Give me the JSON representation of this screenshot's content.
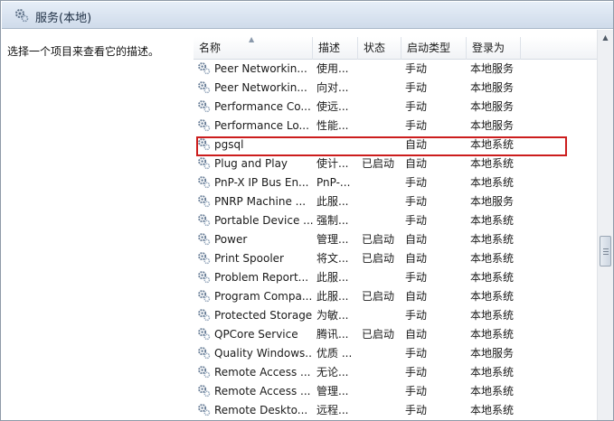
{
  "window": {
    "title": "服务(本地)"
  },
  "left_pane": {
    "description": "选择一个项目来查看它的描述。"
  },
  "columns": {
    "name": "名称",
    "desc": "描述",
    "status": "状态",
    "startup": "启动类型",
    "logon": "登录为"
  },
  "sort": {
    "column": "name",
    "direction": "ascending"
  },
  "services": [
    {
      "name": "Peer Networkin...",
      "desc": "使用...",
      "status": "",
      "startup": "手动",
      "logon": "本地服务"
    },
    {
      "name": "Peer Networkin...",
      "desc": "向对...",
      "status": "",
      "startup": "手动",
      "logon": "本地服务"
    },
    {
      "name": "Performance Co...",
      "desc": "使远...",
      "status": "",
      "startup": "手动",
      "logon": "本地服务"
    },
    {
      "name": "Performance Lo...",
      "desc": "性能...",
      "status": "",
      "startup": "手动",
      "logon": "本地服务"
    },
    {
      "name": "pgsql",
      "desc": "",
      "status": "",
      "startup": "自动",
      "logon": "本地系统",
      "highlighted": true
    },
    {
      "name": "Plug and Play",
      "desc": "使计...",
      "status": "已启动",
      "startup": "自动",
      "logon": "本地系统"
    },
    {
      "name": "PnP-X IP Bus En...",
      "desc": "PnP-...",
      "status": "",
      "startup": "手动",
      "logon": "本地系统"
    },
    {
      "name": "PNRP Machine ...",
      "desc": "此服...",
      "status": "",
      "startup": "手动",
      "logon": "本地服务"
    },
    {
      "name": "Portable Device ...",
      "desc": "强制...",
      "status": "",
      "startup": "手动",
      "logon": "本地系统"
    },
    {
      "name": "Power",
      "desc": "管理...",
      "status": "已启动",
      "startup": "自动",
      "logon": "本地系统"
    },
    {
      "name": "Print Spooler",
      "desc": "将文...",
      "status": "已启动",
      "startup": "自动",
      "logon": "本地系统"
    },
    {
      "name": "Problem Report...",
      "desc": "此服...",
      "status": "",
      "startup": "手动",
      "logon": "本地系统"
    },
    {
      "name": "Program Compa...",
      "desc": "此服...",
      "status": "已启动",
      "startup": "自动",
      "logon": "本地系统"
    },
    {
      "name": "Protected Storage",
      "desc": "为敏...",
      "status": "",
      "startup": "手动",
      "logon": "本地系统"
    },
    {
      "name": "QPCore Service",
      "desc": "腾讯...",
      "status": "已启动",
      "startup": "自动",
      "logon": "本地系统"
    },
    {
      "name": "Quality Windows...",
      "desc": "优质 ...",
      "status": "",
      "startup": "手动",
      "logon": "本地服务"
    },
    {
      "name": "Remote Access ...",
      "desc": "无论...",
      "status": "",
      "startup": "手动",
      "logon": "本地系统"
    },
    {
      "name": "Remote Access ...",
      "desc": "管理...",
      "status": "",
      "startup": "手动",
      "logon": "本地系统"
    },
    {
      "name": "Remote Deskto...",
      "desc": "远程...",
      "status": "",
      "startup": "手动",
      "logon": "本地系统"
    }
  ],
  "icons": {
    "window": "gears-icon",
    "service": "gear-icon"
  },
  "colors": {
    "highlight_border": "#cc1d1d",
    "title_gradient_top": "#e6eef8",
    "title_gradient_bottom": "#cfdbea"
  }
}
